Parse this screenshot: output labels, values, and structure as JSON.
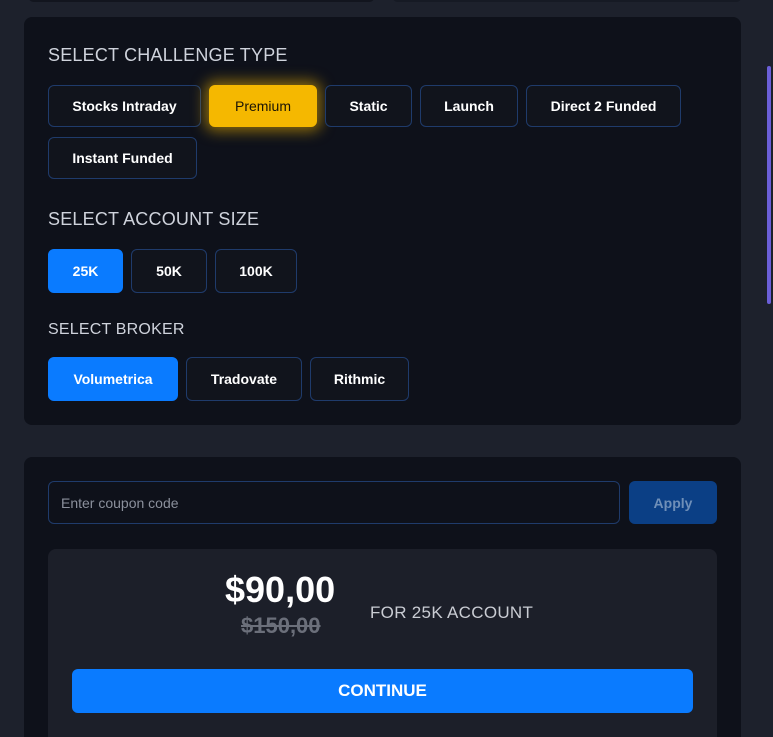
{
  "challenge": {
    "title": "SELECT CHALLENGE TYPE",
    "options": [
      "Stocks Intraday",
      "Premium",
      "Static",
      "Launch",
      "Direct 2 Funded",
      "Instant Funded"
    ],
    "selected": "Premium"
  },
  "account_size": {
    "title": "SELECT ACCOUNT SIZE",
    "options": [
      "25K",
      "50K",
      "100K"
    ],
    "selected": "25K"
  },
  "broker": {
    "title": "SELECT BROKER",
    "options": [
      "Volumetrica",
      "Tradovate",
      "Rithmic"
    ],
    "selected": "Volumetrica"
  },
  "coupon": {
    "placeholder": "Enter coupon code",
    "apply_label": "Apply"
  },
  "pricing": {
    "current": "$90,00",
    "original": "$150,00",
    "caption": "FOR 25K ACCOUNT"
  },
  "continue_label": "CONTINUE",
  "colors": {
    "accent_blue": "#0a7bff",
    "highlight_gold": "#f5b800",
    "card_bg": "#0e111a",
    "page_bg": "#1d212c"
  }
}
